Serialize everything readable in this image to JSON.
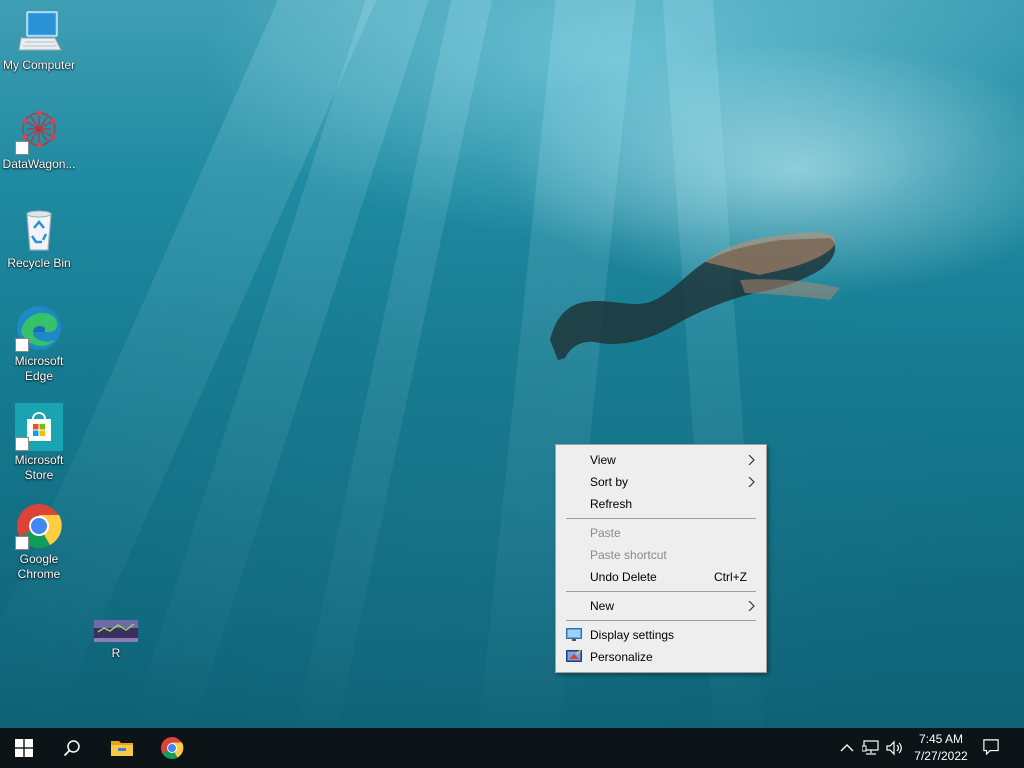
{
  "desktop": {
    "icons": [
      {
        "label": "My Computer",
        "icon": "computer-icon"
      },
      {
        "label": "DataWagon...",
        "icon": "datawagon-icon"
      },
      {
        "label": "Recycle Bin",
        "icon": "recycle-bin-icon"
      },
      {
        "label": "Microsoft Edge",
        "icon": "edge-icon"
      },
      {
        "label": "Microsoft Store",
        "icon": "store-icon"
      },
      {
        "label": "Google Chrome",
        "icon": "chrome-icon"
      },
      {
        "label": "R",
        "icon": "r-image-icon"
      }
    ]
  },
  "context_menu": {
    "view": "View",
    "sort_by": "Sort by",
    "refresh": "Refresh",
    "paste": "Paste",
    "paste_shortcut": "Paste shortcut",
    "undo_delete": "Undo Delete",
    "undo_delete_shortcut": "Ctrl+Z",
    "new": "New",
    "display_settings": "Display settings",
    "personalize": "Personalize"
  },
  "taskbar": {
    "time": "7:45 AM",
    "date": "7/27/2022",
    "pinned": [
      "start-icon",
      "search-icon",
      "file-explorer-icon",
      "chrome-icon"
    ],
    "tray": [
      "chevron-up-icon",
      "network-icon",
      "volume-icon",
      "notification-icon"
    ]
  },
  "colors": {
    "taskbar": "#0d1418",
    "menu_bg": "#eeeeee",
    "disabled_text": "#8a8a8a"
  }
}
